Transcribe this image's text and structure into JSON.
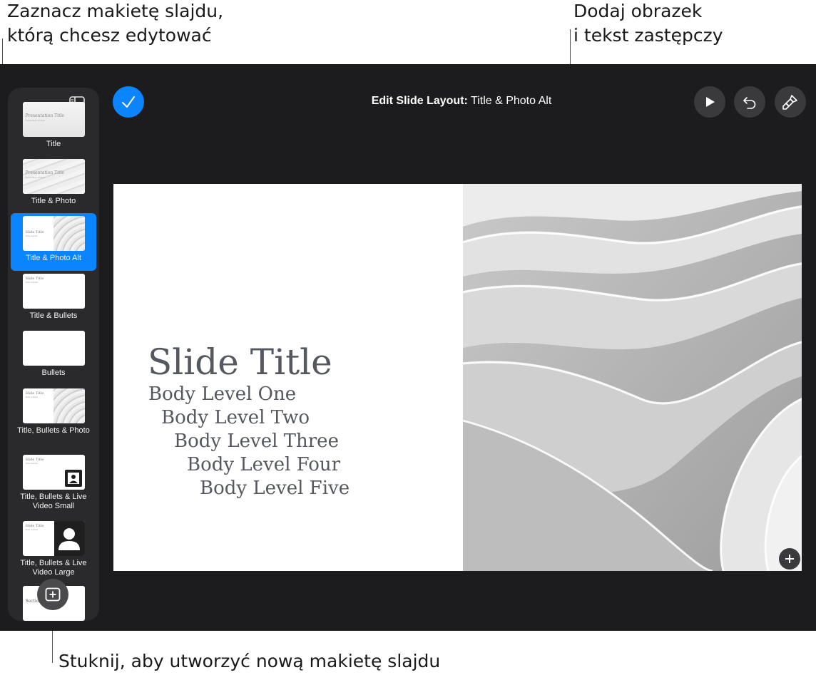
{
  "callouts": {
    "select_layout": "Zaznacz makietę slajdu,\nktórą chcesz edytować",
    "add_placeholders": "Dodaj obrazek\ni tekst zastępczy",
    "create_layout": "Stuknij, aby utworzyć nową makietę slajdu"
  },
  "header": {
    "title_prefix": "Edit Slide Layout:",
    "layout_name": "Title & Photo Alt"
  },
  "icons": {
    "done": "checkmark-icon",
    "play": "play-icon",
    "undo": "undo-icon",
    "format": "paintbrush-icon",
    "sidebar": "sidebar-icon",
    "add_layout": "plus-square-icon",
    "add_media": "plus-icon"
  },
  "colors": {
    "accent": "#0a84ff",
    "background": "#1c1c1e",
    "sidebar": "#2a2a2c"
  },
  "sidebar": {
    "layouts": [
      {
        "label": "Title",
        "thumb_title": "Presentation Title",
        "thumb_sub": "Presentation Subtitle"
      },
      {
        "label": "Title & Photo",
        "thumb_title": "Presentation Title",
        "thumb_sub": "Presentation Subtitle"
      },
      {
        "label": "Title & Photo Alt",
        "thumb_title": "Slide Title",
        "thumb_sub": "Slide Subtitle"
      },
      {
        "label": "Title & Bullets",
        "thumb_title": "Slide Title",
        "thumb_sub": "Slide Subtitle"
      },
      {
        "label": "Bullets"
      },
      {
        "label": "Title, Bullets & Photo",
        "thumb_title": "Slide Title",
        "thumb_sub": "Slide Subtitle"
      },
      {
        "label": "Title, Bullets & Live Video Small",
        "thumb_title": "Slide Title",
        "thumb_sub": "Slide Subtitle"
      },
      {
        "label": "Title, Bullets & Live Video Large",
        "thumb_title": "Slide Title",
        "thumb_sub": "Slide Subtitle"
      },
      {
        "thumb_title": "Section"
      }
    ]
  },
  "slide": {
    "title": "Slide Title",
    "body": [
      "Body Level One",
      "Body Level Two",
      "Body Level Three",
      "Body Level Four",
      "Body Level Five"
    ]
  }
}
